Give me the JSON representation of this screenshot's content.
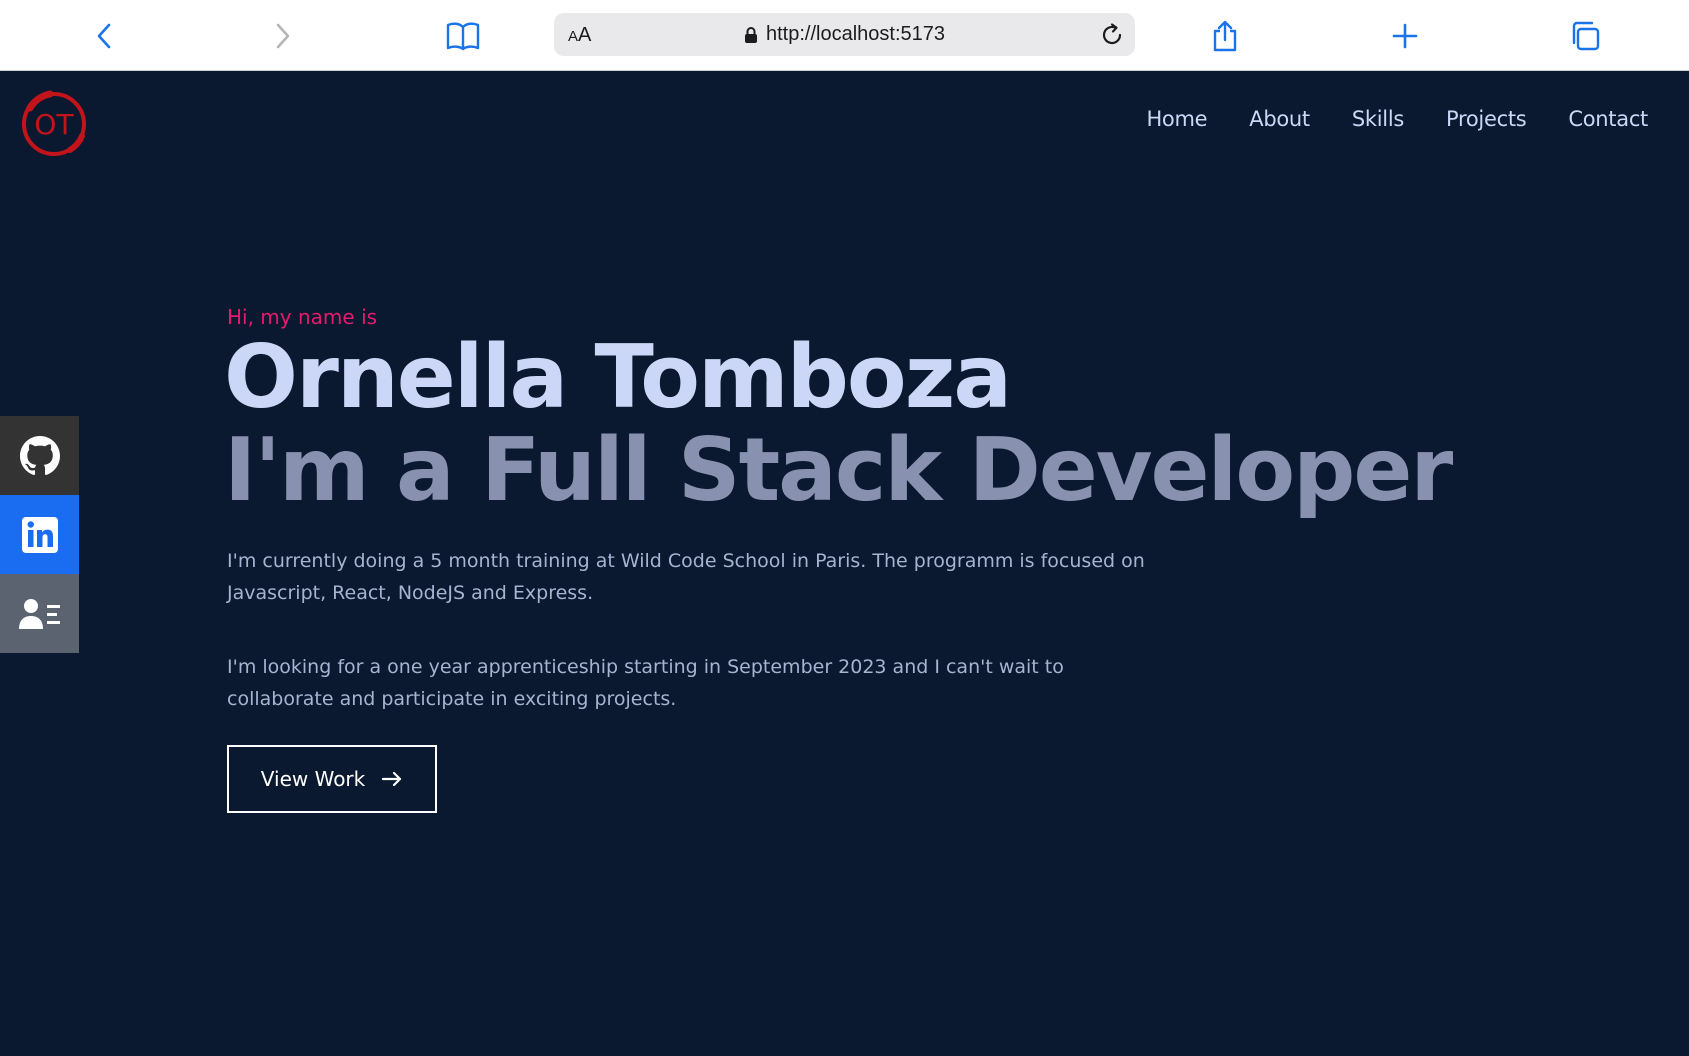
{
  "browser": {
    "aa_label_small": "A",
    "aa_label_big": "A",
    "url": "http://localhost:5173"
  },
  "logo": {
    "text": "OT",
    "color": "#c4141b"
  },
  "nav": {
    "items": [
      {
        "label": "Home"
      },
      {
        "label": "About"
      },
      {
        "label": "Skills"
      },
      {
        "label": "Projects"
      },
      {
        "label": "Contact"
      }
    ]
  },
  "social": {
    "items": [
      {
        "icon": "github-icon",
        "color": "#333333"
      },
      {
        "icon": "linkedin-icon",
        "color": "#1a6df0"
      },
      {
        "icon": "resume-icon",
        "color": "#5b6370"
      }
    ]
  },
  "hero": {
    "greeting": "Hi, my name is",
    "name": "Ornella Tomboza",
    "role": "I'm a Full Stack Developer",
    "paragraph1": "I'm currently doing a 5 month training at Wild Code School in Paris. The programm is focused on Javascript, React, NodeJS and Express.",
    "paragraph2": "I'm looking for a one year apprenticeship starting in September 2023 and I can't wait to collaborate and participate in exciting projects.",
    "button_label": "View Work",
    "button_icon": "arrow-right-icon"
  },
  "colors": {
    "background": "#0a192f",
    "accent": "#e31b6d",
    "heading": "#ccd6f6",
    "subheading": "#8892b0",
    "text": "#a8b2d1",
    "browser_blue": "#1a73e8"
  }
}
